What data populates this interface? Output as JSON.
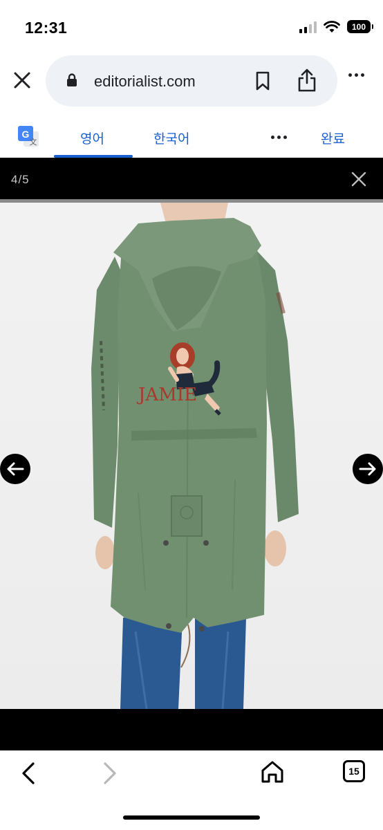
{
  "status": {
    "time": "12:31",
    "battery": "100"
  },
  "browser": {
    "url": "editorialist.com",
    "icons": [
      "close-icon",
      "lock-icon",
      "bookmark-icon",
      "share-icon",
      "more-icon"
    ]
  },
  "translate": {
    "source_tab": "영어",
    "target_tab": "한국어",
    "done_label": "완료",
    "accent_color": "#1a5fd0"
  },
  "gallery": {
    "counter": "4/5",
    "image_text": "JAMIE",
    "background": "#000000"
  },
  "toolbar": {
    "tab_count": "15",
    "icons": [
      "back-icon",
      "forward-icon",
      "home-icon",
      "tabs-icon"
    ]
  }
}
